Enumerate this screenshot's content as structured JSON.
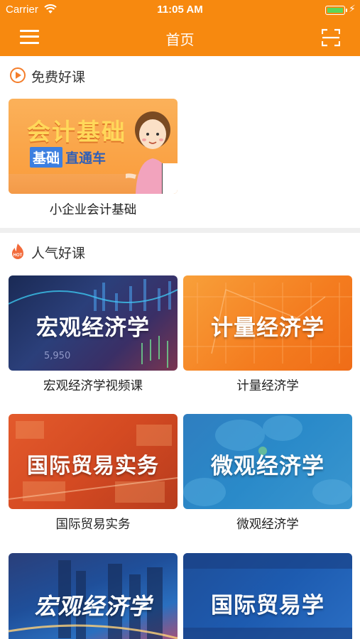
{
  "status_bar": {
    "carrier": "Carrier",
    "time": "11:05 AM"
  },
  "nav": {
    "title": "首页"
  },
  "free_section": {
    "title": "免费好课",
    "courses": [
      {
        "thumb_title": "会计基础",
        "thumb_tag": "基础",
        "thumb_tag_suffix": "直通车",
        "caption": "小企业会计基础"
      }
    ]
  },
  "popular_section": {
    "title": "人气好课",
    "courses": [
      {
        "thumb_title": "宏观经济学",
        "caption": "宏观经济学视频课"
      },
      {
        "thumb_title": "计量经济学",
        "caption": "计量经济学"
      },
      {
        "thumb_title": "国际贸易实务",
        "caption": "国际贸易实务"
      },
      {
        "thumb_title": "微观经济学",
        "caption": "微观经济学"
      },
      {
        "thumb_title": "宏观经济学",
        "caption": ""
      },
      {
        "thumb_title": "国际贸易学",
        "caption": ""
      }
    ]
  },
  "thumb_decorations": {
    "macro_ticker": "5,950"
  },
  "colors": {
    "brand_orange": "#f7890f",
    "accent_orange": "#f47d2a",
    "battery_green": "#5bd65a"
  },
  "icons": [
    "menu-icon",
    "scan-icon",
    "play-icon",
    "hot-icon",
    "wifi-icon",
    "battery-icon"
  ]
}
